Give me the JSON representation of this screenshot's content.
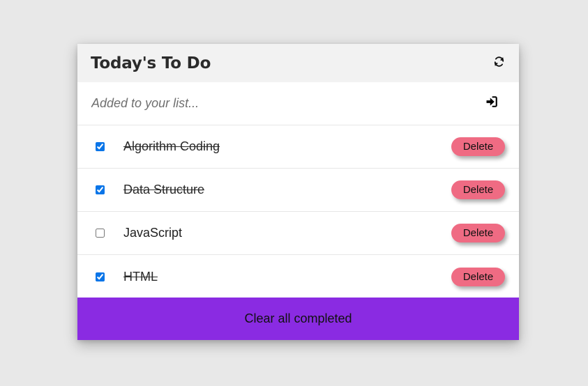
{
  "header": {
    "title": "Today's To Do",
    "refresh_icon": "refresh-icon"
  },
  "add": {
    "placeholder": "Added to your list...",
    "value": "",
    "submit_icon": "sign-in-icon"
  },
  "items": [
    {
      "label": "Algorithm Coding",
      "completed": true,
      "delete_label": "Delete"
    },
    {
      "label": "Data Structure",
      "completed": true,
      "delete_label": "Delete"
    },
    {
      "label": "JavaScript",
      "completed": false,
      "delete_label": "Delete"
    },
    {
      "label": "HTML",
      "completed": true,
      "delete_label": "Delete"
    }
  ],
  "footer": {
    "clear_label": "Clear all completed"
  },
  "colors": {
    "page_background": "#e8e8e8",
    "header_background": "#f2f2f2",
    "delete_button": "#ef6b83",
    "footer_background": "#8a2be2",
    "checkbox_accent": "#0a75e8"
  }
}
